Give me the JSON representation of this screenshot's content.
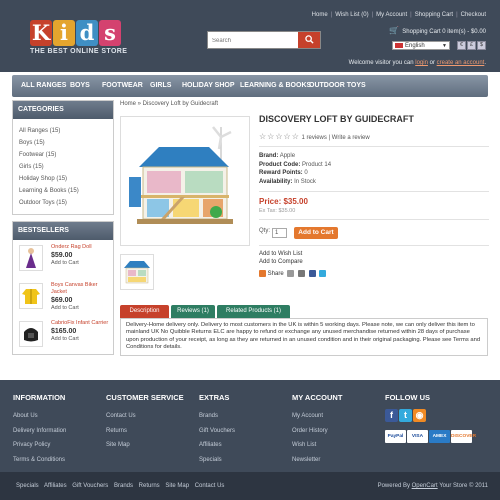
{
  "header": {
    "logo_letters": [
      "K",
      "i",
      "d",
      "s"
    ],
    "logo_tagline": "THE BEST ONLINE STORE",
    "top_links": [
      "Home",
      "Wish List (0)",
      "My Account",
      "Shopping Cart",
      "Checkout"
    ],
    "search_placeholder": "Search",
    "cart_text": "Shopping Cart 0 item(s) - $0.00",
    "language": "English",
    "currencies": [
      "€",
      "£",
      "$"
    ],
    "welcome_prefix": "Welcome visitor you can",
    "welcome_login": "login",
    "welcome_or": "or",
    "welcome_create": "create an account",
    "welcome_suffix": "."
  },
  "nav": [
    "All Ranges",
    "Boys",
    "Footwear",
    "Girls",
    "Holiday Shop",
    "Learning & Books",
    "Outdoor Toys"
  ],
  "categories": {
    "title": "Categories",
    "items": [
      "All Ranges (15)",
      "Boys (15)",
      "Footwear (15)",
      "Girls (15)",
      "Holiday Shop (15)",
      "Learning & Books (15)",
      "Outdoor Toys (15)"
    ]
  },
  "bestsellers": {
    "title": "Bestsellers",
    "items": [
      {
        "name": "Onderz Rag Doll",
        "price": "$59.00",
        "add": "Add to Cart"
      },
      {
        "name": "Boys Canvas Biker Jacket",
        "price": "$69.00",
        "add": "Add to Cart"
      },
      {
        "name": "CabrioFix Infant Carrier",
        "price": "$165.00",
        "add": "Add to Cart"
      }
    ]
  },
  "breadcrumb": "Home » Discovery Loft by Guidecraft",
  "product": {
    "title": "Discovery Loft by Guidecraft",
    "reviews": "1 reviews",
    "write_review": "Write a review",
    "brand_label": "Brand:",
    "brand": "Apple",
    "code_label": "Product Code:",
    "code": "Product 14",
    "points_label": "Reward Points:",
    "points": "0",
    "avail_label": "Availability:",
    "avail": "In Stock",
    "price": "Price: $35.00",
    "ex_tax": "Ex Tax: $35.00",
    "qty_label": "Qty:",
    "qty": "1",
    "add_to_cart": "Add to Cart",
    "wishlist": "Add to Wish List",
    "compare": "Add to Compare",
    "share": "Share"
  },
  "tabs": [
    "Description",
    "Reviews (1)",
    "Related Products (1)"
  ],
  "description": "Delivery-Home delivery only. Delivery to most customers in the UK is within 5 working days. Please note, we can only deliver this item to mainland UK No Quibble Returns ELC are happy to refund or exchange any unused merchandise returned within 28 days of purchase upon production of your receipt, as long as they are returned in an unused condition and in their original packaging. Please see Terms and Conditions for details.",
  "footer": {
    "columns": [
      {
        "title": "Information",
        "links": [
          "About Us",
          "Delivery Information",
          "Privacy Policy",
          "Terms & Conditions"
        ]
      },
      {
        "title": "Customer Service",
        "links": [
          "Contact Us",
          "Returns",
          "Site Map"
        ]
      },
      {
        "title": "Extras",
        "links": [
          "Brands",
          "Gift Vouchers",
          "Affiliates",
          "Specials"
        ]
      },
      {
        "title": "My Account",
        "links": [
          "My Account",
          "Order History",
          "Wish List",
          "Newsletter"
        ]
      }
    ],
    "follow_title": "Follow Us",
    "payments": [
      "PayPal",
      "VISA",
      "AMEX",
      "DISCOVER"
    ],
    "bottom_links": [
      "Specials",
      "Affiliates",
      "Gift Vouchers",
      "Brands",
      "Returns",
      "Site Map",
      "Contact Us"
    ],
    "powered_prefix": "Powered By",
    "powered_link": "OpenCart",
    "powered_suffix": "Your Store © 2011"
  },
  "colors": {
    "header_bg": "#3f4a59",
    "accent_red": "#c6412b",
    "button_orange": "#e4782e",
    "tab_red": "#c6412b",
    "tab_green": "#2e7d62"
  }
}
